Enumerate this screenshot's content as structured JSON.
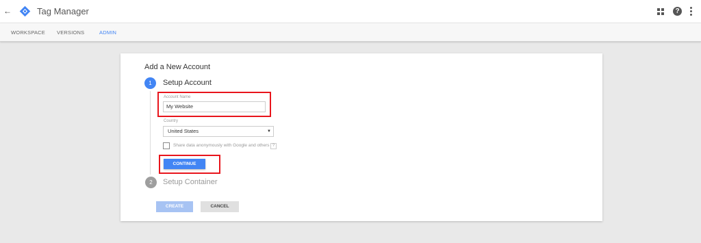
{
  "app": {
    "title": "Tag Manager"
  },
  "tabs": [
    {
      "label": "WORKSPACE"
    },
    {
      "label": "VERSIONS"
    },
    {
      "label": "ADMIN",
      "active": true
    }
  ],
  "form": {
    "title": "Add a New Account",
    "step1": {
      "number": "1",
      "label": "Setup Account"
    },
    "account_name": {
      "label": "Account Name",
      "value": "My Website"
    },
    "country": {
      "label": "Country",
      "value": "United States"
    },
    "share": {
      "label": "Share data anonymously with Google and others",
      "checked": false,
      "info": "?"
    },
    "continue_label": "CONTINUE",
    "step2": {
      "number": "2",
      "label": "Setup Container"
    },
    "create_label": "CREATE",
    "cancel_label": "CANCEL"
  },
  "colors": {
    "accent": "#4285f4",
    "highlight": "#e8141b",
    "create_disabled": "#a7c3f3"
  },
  "icons": [
    "back-arrow-icon",
    "tag-manager-logo-icon",
    "apps-grid-icon",
    "help-icon",
    "more-vert-icon",
    "info-icon"
  ]
}
